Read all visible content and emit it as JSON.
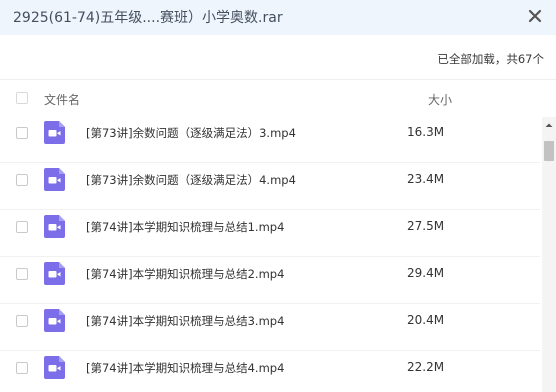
{
  "dialog": {
    "title": "2925(61-74)五年级....赛班）小学奥数.rar",
    "close_icon": "close-icon"
  },
  "status": {
    "text": "已全部加载，共67个"
  },
  "table": {
    "columns": {
      "name": "文件名",
      "size": "大小"
    },
    "rows": [
      {
        "name": "[第73讲]余数问题（逐级满足法）3.mp4",
        "size": "16.3M",
        "icon": "video-file-icon"
      },
      {
        "name": "[第73讲]余数问题（逐级满足法）4.mp4",
        "size": "23.4M",
        "icon": "video-file-icon"
      },
      {
        "name": "[第74讲]本学期知识梳理与总结1.mp4",
        "size": "27.5M",
        "icon": "video-file-icon"
      },
      {
        "name": "[第74讲]本学期知识梳理与总结2.mp4",
        "size": "29.4M",
        "icon": "video-file-icon"
      },
      {
        "name": "[第74讲]本学期知识梳理与总结3.mp4",
        "size": "20.4M",
        "icon": "video-file-icon"
      },
      {
        "name": "[第74讲]本学期知识梳理与总结4.mp4",
        "size": "22.2M",
        "icon": "video-file-icon"
      }
    ]
  },
  "colors": {
    "titlebar_bg": "#eef5fd",
    "file_icon": "#7b6ee8",
    "scrollbar_thumb": "#c2c2c2"
  }
}
